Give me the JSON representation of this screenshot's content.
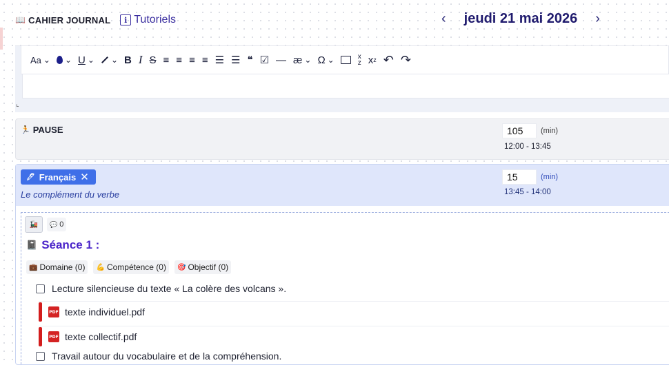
{
  "header": {
    "brand_icon": "📖",
    "brand": "CAHIER JOURNAL",
    "tutorials_icon": "i",
    "tutorials": "Tutoriels",
    "prev_arrow": "‹",
    "date": "jeudi 21 mai 2026",
    "next_arrow": "›"
  },
  "toolbar": {
    "font_size": "Aa",
    "color": "💧",
    "underline": "U",
    "highlight": "🖊",
    "bold": "B",
    "italic": "I",
    "strike": "S",
    "align_left": "≡",
    "align_center": "≡",
    "align_right": "≡",
    "justify": "≡",
    "bullets": "☰",
    "numbered": "☰",
    "quote": "❝",
    "checklist": "☑",
    "hr": "—",
    "ligature": "æ",
    "special_char": "Ω",
    "image": "🖼",
    "subscript": "x",
    "superscript": "x",
    "undo": "↶",
    "redo": "↷",
    "chevron": "⌄"
  },
  "pause": {
    "icon": "🏃",
    "title": "PAUSE",
    "minutes": "105",
    "unit": "(min)",
    "time_range": "12:00 - 13:45"
  },
  "francais": {
    "chip_icon": "🖊",
    "subject": "Français",
    "close": "✕",
    "subtitle": "Le complément du verbe",
    "minutes": "15",
    "unit": "(min)",
    "time_range": "13:45 - 14:00"
  },
  "session": {
    "mini_icon": "🚂",
    "comment_icon": "💬",
    "comment_count": "0",
    "seance_icon": "📓",
    "seance_title": "Séance 1 :",
    "tags": [
      {
        "icon": "💼",
        "label": "Domaine (0)"
      },
      {
        "icon": "💪",
        "label": "Compétence (0)"
      },
      {
        "icon": "🎯",
        "label": "Objectif (0)"
      }
    ],
    "task1": "Lecture silencieuse du texte « La colère des volcans ».",
    "files": [
      {
        "badge": "PDF",
        "name": "texte individuel.pdf"
      },
      {
        "badge": "PDF",
        "name": "texte collectif.pdf"
      }
    ],
    "task2": "Travail autour du vocabulaire et de la compréhension."
  }
}
